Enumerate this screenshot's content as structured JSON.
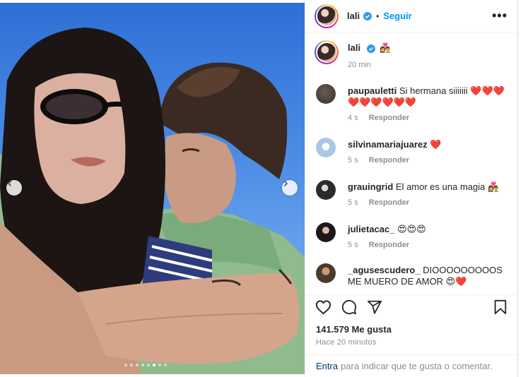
{
  "post": {
    "username": "lali",
    "follow_label": "Seguir",
    "separator": "•",
    "more_label": "•••"
  },
  "caption": {
    "username": "lali",
    "emoji": "👩‍❤️‍👨",
    "time": "20 min"
  },
  "comments": [
    {
      "user": "paupauletti",
      "text": "Si hermana siiiiiii",
      "hearts": "❤️❤️❤️",
      "hearts2": "❤️❤️❤️❤️❤️❤️",
      "time": "4 s",
      "reply": "Responder"
    },
    {
      "user": "silvinamariajuarez",
      "text": "❤️",
      "time": "5 s",
      "reply": "Responder"
    },
    {
      "user": "grauingrid",
      "text": "El amor es una magia 👩‍❤️‍👨",
      "time": "5 s",
      "reply": "Responder"
    },
    {
      "user": "julietacac_",
      "text": "😍😍😍",
      "time": "5 s",
      "reply": "Responder"
    },
    {
      "user": "_agusescudero_",
      "text": "DIOOOOOOOOOS ME MUERO DE AMOR 😍❤️"
    }
  ],
  "actions": {
    "likes": "141.579 Me gusta",
    "time": "Hace 20 minutos"
  },
  "footer": {
    "link": "Entra",
    "text": "para indicar que te gusta o comentar."
  },
  "carousel": {
    "count": 8,
    "active": 5
  },
  "colors": {
    "accent": "#0095f6",
    "verified": "#3897f0",
    "heart": "#e0245e"
  }
}
